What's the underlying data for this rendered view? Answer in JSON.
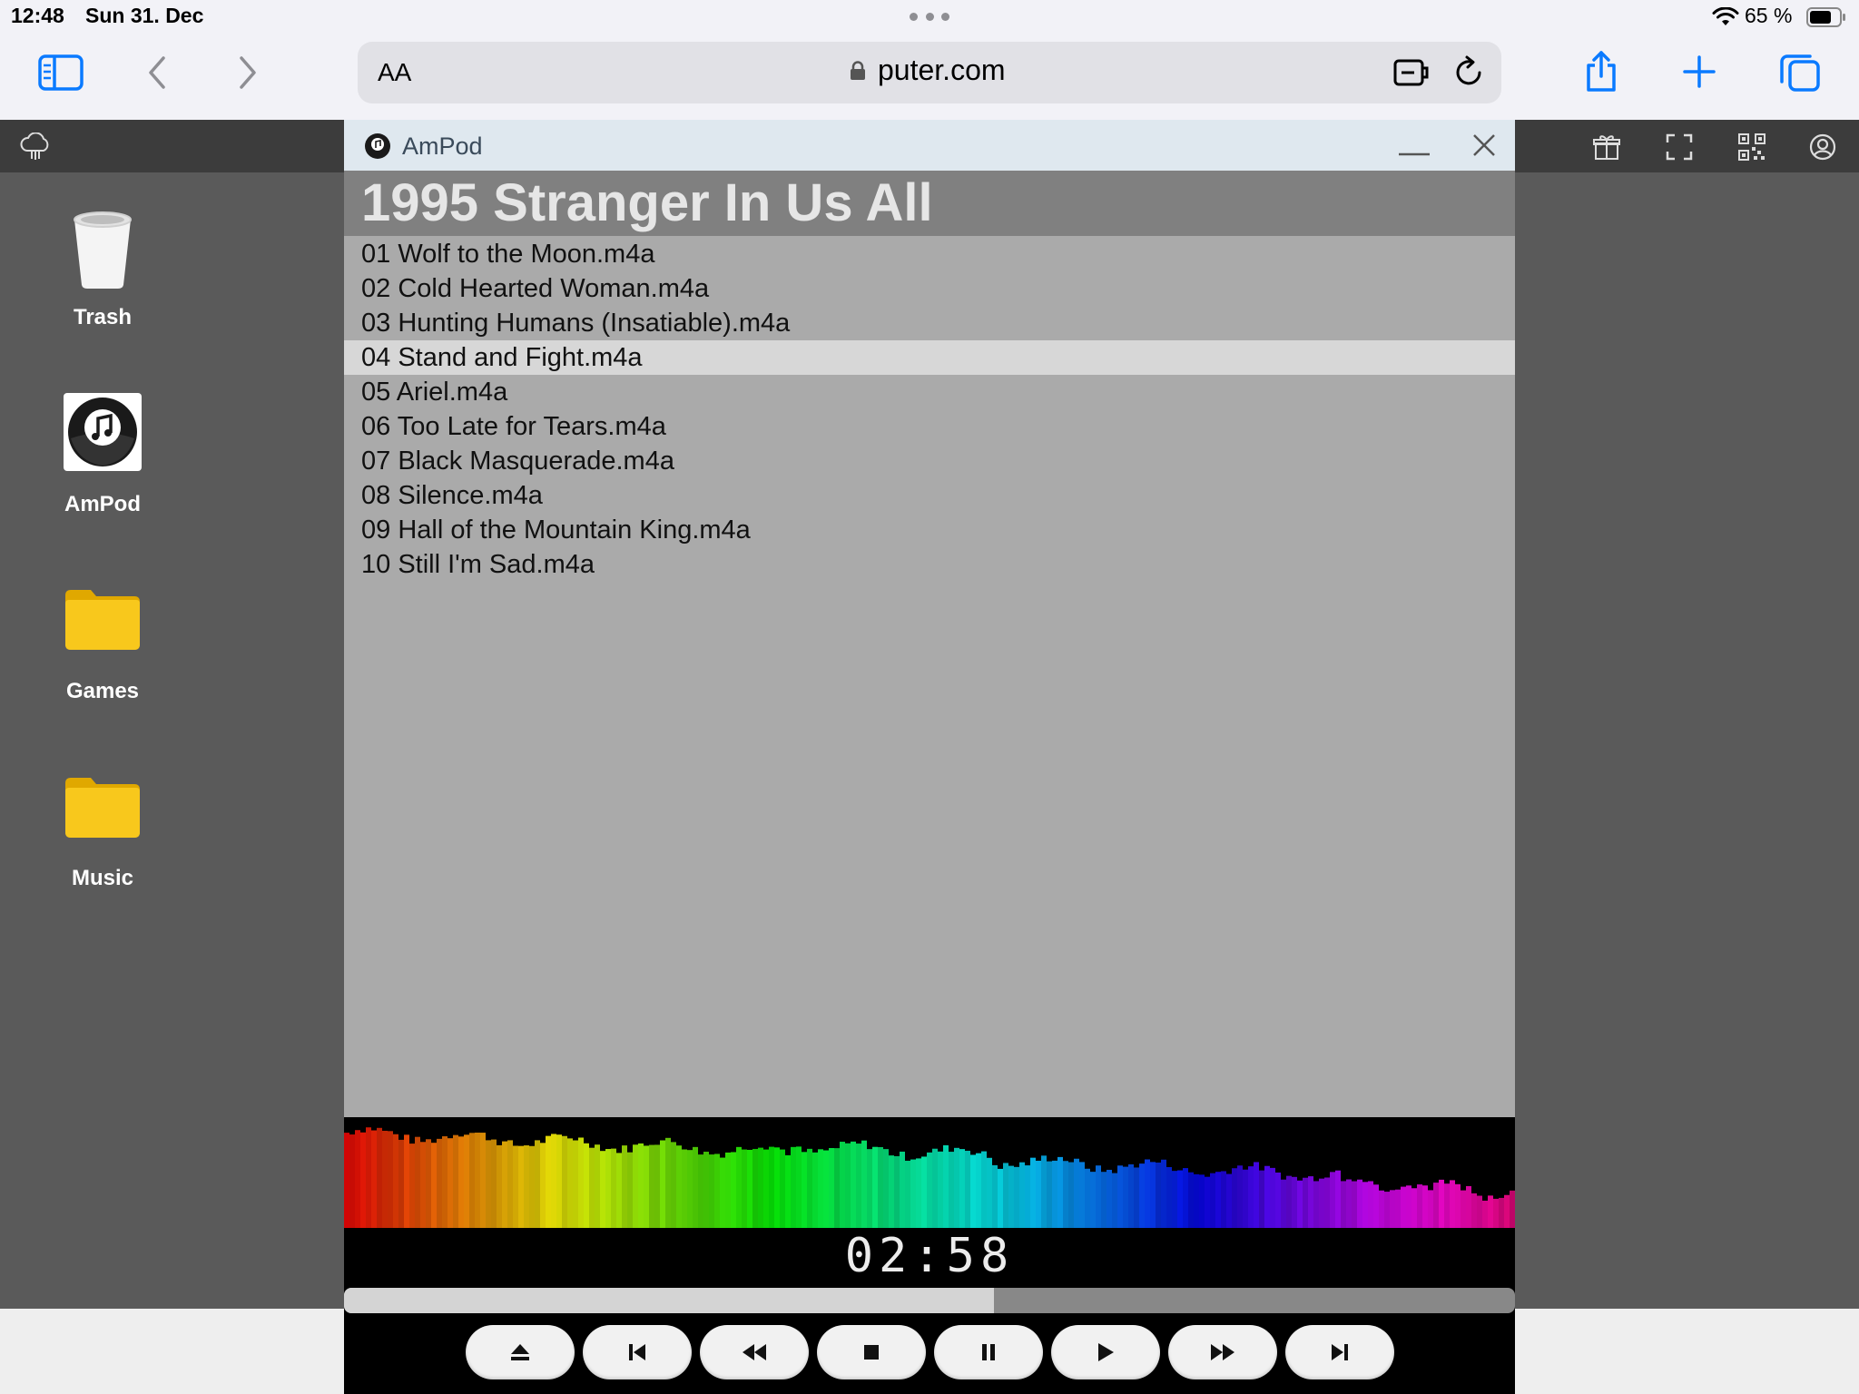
{
  "status_bar": {
    "time": "12:48",
    "date": "Sun 31. Dec",
    "battery": "65 %"
  },
  "browser": {
    "text_size_label": "AA",
    "url": "puter.com"
  },
  "desktop": {
    "icons": [
      {
        "label": "Trash",
        "icon": "trash-icon"
      },
      {
        "label": "AmPod",
        "icon": "ampod-app-icon"
      },
      {
        "label": "Games",
        "icon": "folder-icon"
      },
      {
        "label": "Music",
        "icon": "folder-icon"
      }
    ]
  },
  "window": {
    "title": "AmPod",
    "album": "1995 Stranger In Us All",
    "tracks": [
      "01 Wolf to the Moon.m4a",
      "02 Cold Hearted Woman.m4a",
      "03 Hunting Humans (Insatiable).m4a",
      "04 Stand and Fight.m4a",
      "05 Ariel.m4a",
      "06 Too Late for Tears.m4a",
      "07 Black Masquerade.m4a",
      "08 Silence.m4a",
      "09 Hall of the Mountain King.m4a",
      "10 Still I'm Sad.m4a"
    ],
    "selected_track_index": 3,
    "elapsed_time": "02:58",
    "progress_fraction": 0.555,
    "controls": [
      "eject-icon",
      "previous-track-icon",
      "rewind-icon",
      "stop-icon",
      "pause-icon",
      "play-icon",
      "fast-forward-icon",
      "next-track-icon"
    ]
  },
  "colors": {
    "accent": "#0a7aff",
    "folder": "#f5c518",
    "selected_row": "#d7d7d7"
  }
}
